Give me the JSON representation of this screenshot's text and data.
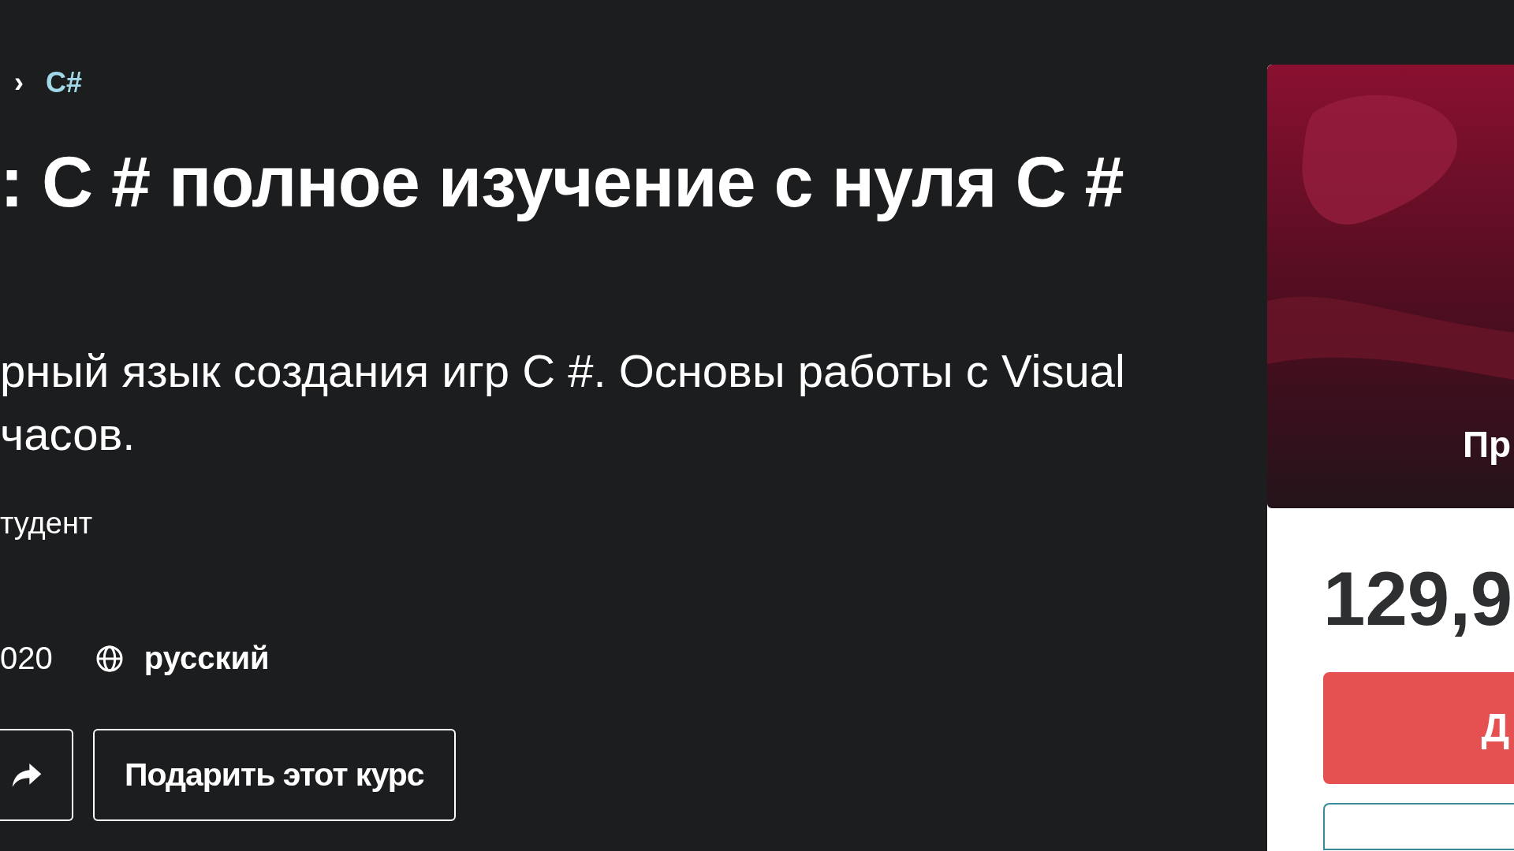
{
  "breadcrumb": {
    "separator": "›",
    "current": "C#"
  },
  "title": ": C # полное изучение с нуля C #",
  "subtitle": [
    "рный язык создания игр C #. Основы работы с Visual",
    "часов."
  ],
  "students": "тудент",
  "meta": {
    "date": "020",
    "language": "русский"
  },
  "actions": {
    "gift_label": "Подарить этот курс"
  },
  "sidebar": {
    "preview_caption": "Пр",
    "price": "129,9",
    "primary_button": "Д"
  }
}
